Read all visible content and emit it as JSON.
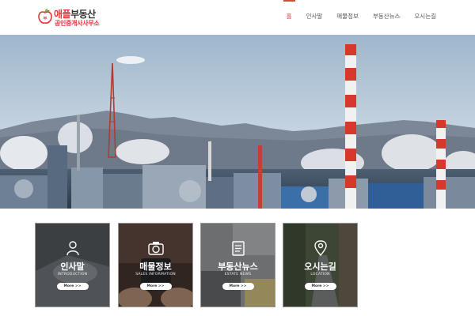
{
  "header": {
    "logo": {
      "title_red": "애플",
      "title_dark": "부동산",
      "subtitle": "공인중개사사무소"
    },
    "nav": [
      {
        "label": "홈",
        "active": true
      },
      {
        "label": "인사말",
        "active": false
      },
      {
        "label": "매물정보",
        "active": false
      },
      {
        "label": "부동산뉴스",
        "active": false
      },
      {
        "label": "오시는길",
        "active": false
      }
    ]
  },
  "cards": [
    {
      "title": "인사말",
      "subtitle": "INTRODUCTION",
      "button": "More >>",
      "icon": "person-icon"
    },
    {
      "title": "매물정보",
      "subtitle": "SALES INFORMATION",
      "button": "More >>",
      "icon": "camera-icon"
    },
    {
      "title": "부동산뉴스",
      "subtitle": "ESTATE NEWS",
      "button": "More >>",
      "icon": "document-icon"
    },
    {
      "title": "오시는길",
      "subtitle": "LOCATION",
      "button": "More >>",
      "icon": "location-pin-icon"
    }
  ],
  "colors": {
    "accent": "#d94a3a",
    "brand_red": "#e8323c"
  }
}
